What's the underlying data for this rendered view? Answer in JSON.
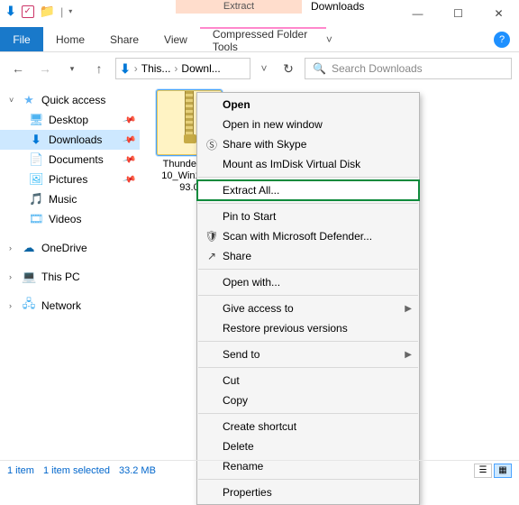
{
  "titlebar": {
    "context_tab_category": "Extract",
    "window_title": "Downloads"
  },
  "ribbon": {
    "file": "File",
    "tabs": [
      "Home",
      "Share",
      "View"
    ],
    "context_tab": "Compressed Folder Tools"
  },
  "address": {
    "crumbs": [
      "This...",
      "Downl..."
    ],
    "search_placeholder": "Search Downloads"
  },
  "nav": {
    "quick_access": "Quick access",
    "items": [
      {
        "label": "Desktop",
        "pinned": true
      },
      {
        "label": "Downloads",
        "pinned": true,
        "selected": true
      },
      {
        "label": "Documents",
        "pinned": true
      },
      {
        "label": "Pictures",
        "pinned": true
      },
      {
        "label": "Music",
        "pinned": false
      },
      {
        "label": "Videos",
        "pinned": false
      }
    ],
    "onedrive": "OneDrive",
    "thispc": "This PC",
    "network": "Network"
  },
  "content": {
    "file": {
      "name_line1": "Thunderbolt",
      "name_line2": "10_Win11-1.",
      "name_line3": "93.0"
    }
  },
  "contextmenu": {
    "open": "Open",
    "open_new_window": "Open in new window",
    "share_skype": "Share with Skype",
    "mount_imdisk": "Mount as ImDisk Virtual Disk",
    "extract_all": "Extract All...",
    "pin_start": "Pin to Start",
    "scan_defender": "Scan with Microsoft Defender...",
    "share": "Share",
    "open_with": "Open with...",
    "give_access": "Give access to",
    "restore_prev": "Restore previous versions",
    "send_to": "Send to",
    "cut": "Cut",
    "copy": "Copy",
    "create_shortcut": "Create shortcut",
    "delete": "Delete",
    "rename": "Rename",
    "properties": "Properties"
  },
  "status": {
    "item_count": "1 item",
    "selection": "1 item selected",
    "size": "33.2 MB"
  }
}
